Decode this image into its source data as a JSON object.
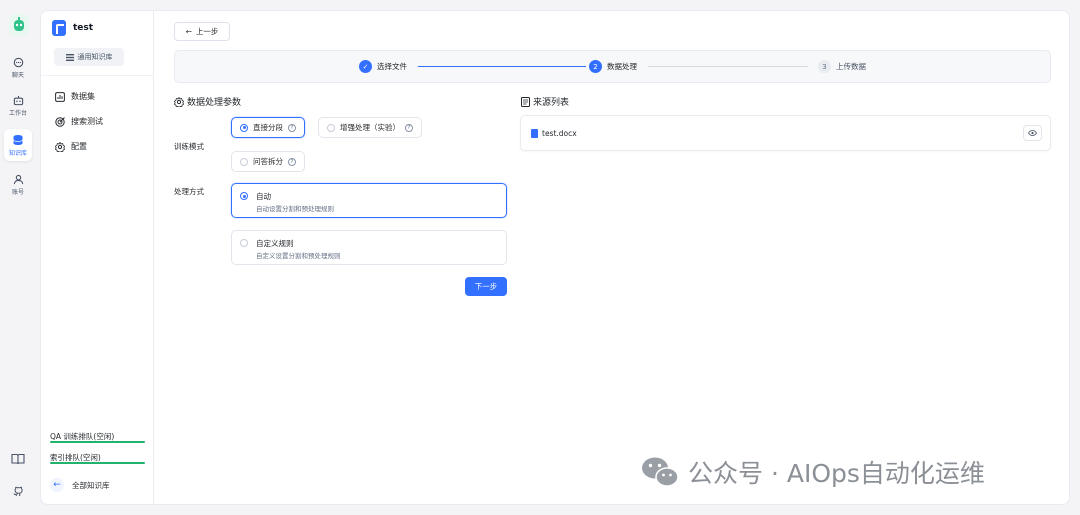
{
  "rail": {
    "items": [
      {
        "label": "聊天",
        "icon": "chat-icon"
      },
      {
        "label": "工作台",
        "icon": "robot-icon"
      },
      {
        "label": "知识库",
        "icon": "database-icon",
        "active": true
      },
      {
        "label": "账号",
        "icon": "user-icon"
      }
    ],
    "bottom_icons": [
      "book-icon",
      "github-icon"
    ]
  },
  "sidebar": {
    "kb_name": "test",
    "kb_type": "通用知识库",
    "nav": [
      {
        "label": "数据集",
        "icon": "chart-icon"
      },
      {
        "label": "搜索测试",
        "icon": "target-icon"
      },
      {
        "label": "配置",
        "icon": "gear-icon"
      }
    ],
    "queues": [
      "QA 训练排队(空闲)",
      "索引排队(空闲)"
    ],
    "back_label": "全部知识库"
  },
  "content": {
    "prev_label": "上一步",
    "steps": [
      {
        "num": "✓",
        "label": "选择文件",
        "state": "done"
      },
      {
        "num": "2",
        "label": "数据处理",
        "state": "active"
      },
      {
        "num": "3",
        "label": "上传数据",
        "state": "todo"
      }
    ],
    "params_title": "数据处理参数",
    "train_mode_label": "训练模式",
    "train_modes": [
      "直接分段",
      "增强处理（实验）",
      "问答拆分"
    ],
    "process_label": "处理方式",
    "methods": [
      {
        "title": "自动",
        "desc": "自动设置分割和预处理规则"
      },
      {
        "title": "自定义规则",
        "desc": "自定义设置分割和预处理规则"
      }
    ],
    "next_label": "下一步",
    "source_title": "来源列表",
    "files": [
      "test.docx"
    ]
  },
  "watermark": "公众号 · AIOps自动化运维",
  "colors": {
    "primary": "#3370ff",
    "success": "#21b36b"
  }
}
